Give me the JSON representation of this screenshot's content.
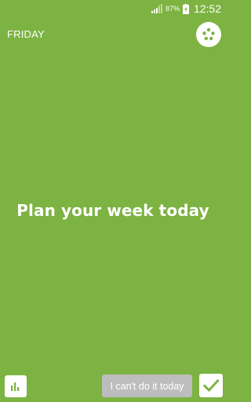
{
  "status_bar": {
    "battery_percent": "87%",
    "time": "12:52",
    "icons": [
      "signal-icon",
      "battery-charging-icon"
    ]
  },
  "header": {
    "day": "FRIDAY",
    "menu_icon": "dots-menu-icon"
  },
  "main": {
    "headline": "Plan your week today"
  },
  "footer": {
    "stats_icon": "bar-chart-icon",
    "cant_label": "I can't do it today",
    "done_icon": "checkmark-icon"
  },
  "colors": {
    "background": "#7cb342",
    "accent": "#7cb342",
    "button_gray": "#bdbdbd",
    "white": "#ffffff"
  }
}
